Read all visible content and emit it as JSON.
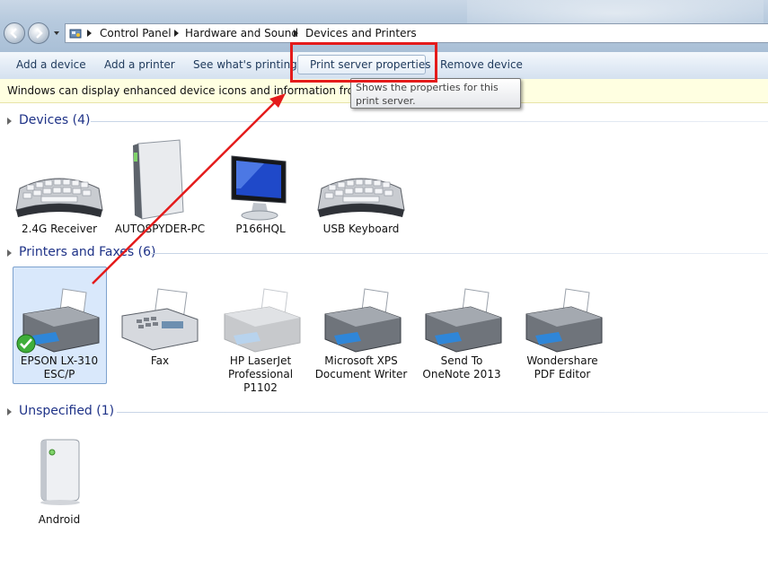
{
  "breadcrumb": [
    "Control Panel",
    "Hardware and Sound",
    "Devices and Printers"
  ],
  "toolbar": {
    "add_device": "Add a device",
    "add_printer": "Add a printer",
    "see_printing": "See what's printing",
    "print_server": "Print server properties",
    "remove_device": "Remove device"
  },
  "infobar": {
    "text": "Windows can display enhanced device icons and information from the Internet. Click to change..."
  },
  "tooltip": {
    "text": "Shows the properties for this print server."
  },
  "groups": {
    "devices": {
      "title": "Devices (4)",
      "items": [
        "2.4G Receiver",
        "AUTOSPYDER-PC",
        "P166HQL",
        "USB Keyboard"
      ]
    },
    "printers": {
      "title": "Printers and Faxes (6)",
      "items": [
        [
          "EPSON LX-310",
          "ESC/P"
        ],
        [
          "Fax"
        ],
        [
          "HP LaserJet",
          "Professional",
          "P1102"
        ],
        [
          "Microsoft XPS",
          "Document Writer"
        ],
        [
          "Send To",
          "OneNote 2013"
        ],
        [
          "Wondershare",
          "PDF Editor"
        ]
      ]
    },
    "unspecified": {
      "title": "Unspecified (1)",
      "items": [
        "Android"
      ]
    }
  },
  "colors": {
    "annotation": "#e41b1b",
    "group_title": "#1e3287"
  }
}
